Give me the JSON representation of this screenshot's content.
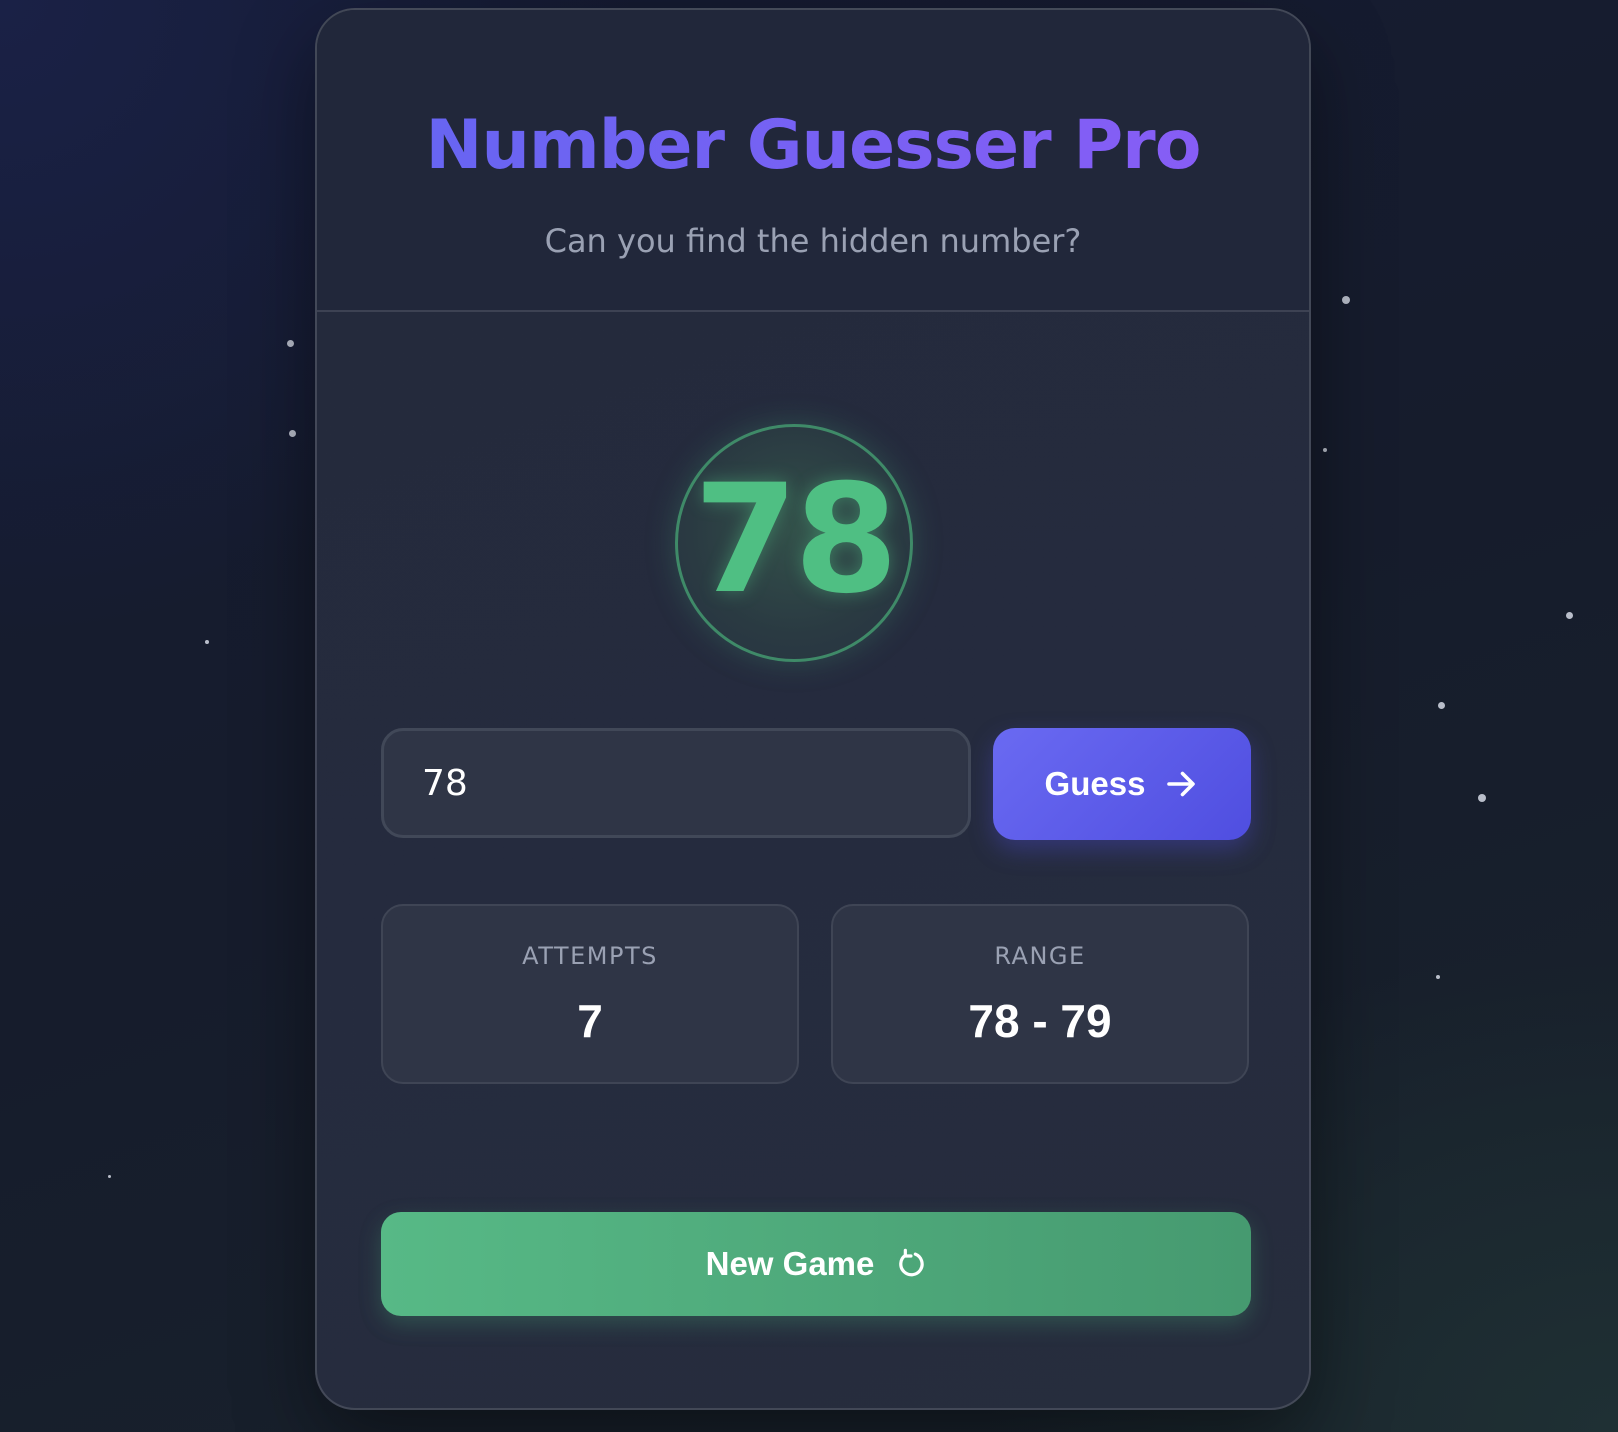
{
  "game": {
    "title": "Number Guesser Pro",
    "subtitle": "Can you find the hidden number?",
    "displayed_number": "78"
  },
  "guess_form": {
    "input_value": "78",
    "button_label": "Guess",
    "button_icon": "arrow-right-icon"
  },
  "stats": {
    "attempts_label": "ATTEMPTS",
    "attempts_value": "7",
    "range_label": "RANGE",
    "range_value": "78 - 79"
  },
  "new_game": {
    "label": "New Game",
    "icon": "restart-icon"
  },
  "colors": {
    "title_gradient_start": "#6366f1",
    "title_gradient_end": "#8b5cf6",
    "success_green": "#4fbf83",
    "guess_button": "#5b5bea",
    "new_game_button": "#51ad7e"
  }
}
